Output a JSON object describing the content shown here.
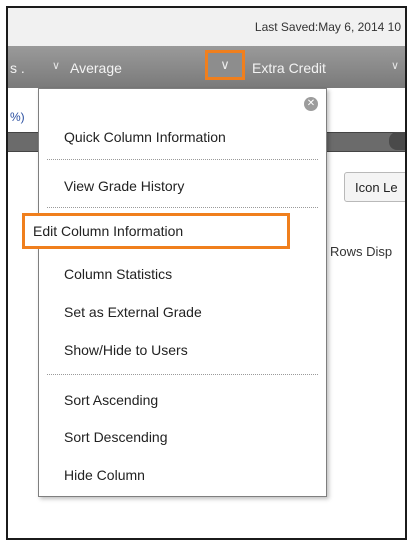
{
  "status": {
    "last_saved": "Last Saved:May 6, 2014 10"
  },
  "header": {
    "left_fragment": "s .",
    "average_label": "Average",
    "extra_credit_label": "Extra Credit"
  },
  "grid": {
    "percent_fragment": "%)",
    "icon_button_label": "Icon Le",
    "rows_display_label": "Rows Disp"
  },
  "menu": {
    "close_icon": "close-circle",
    "items": [
      "Quick Column Information",
      "View Grade History",
      "Edit Column Information",
      "Column Statistics",
      "Set as External Grade",
      "Show/Hide to Users",
      "Sort Ascending",
      "Sort Descending",
      "Hide Column"
    ],
    "highlighted_item": "Edit Column Information"
  },
  "colors": {
    "highlight": "#f07f1d",
    "header_bg": "#8d8d8d"
  }
}
